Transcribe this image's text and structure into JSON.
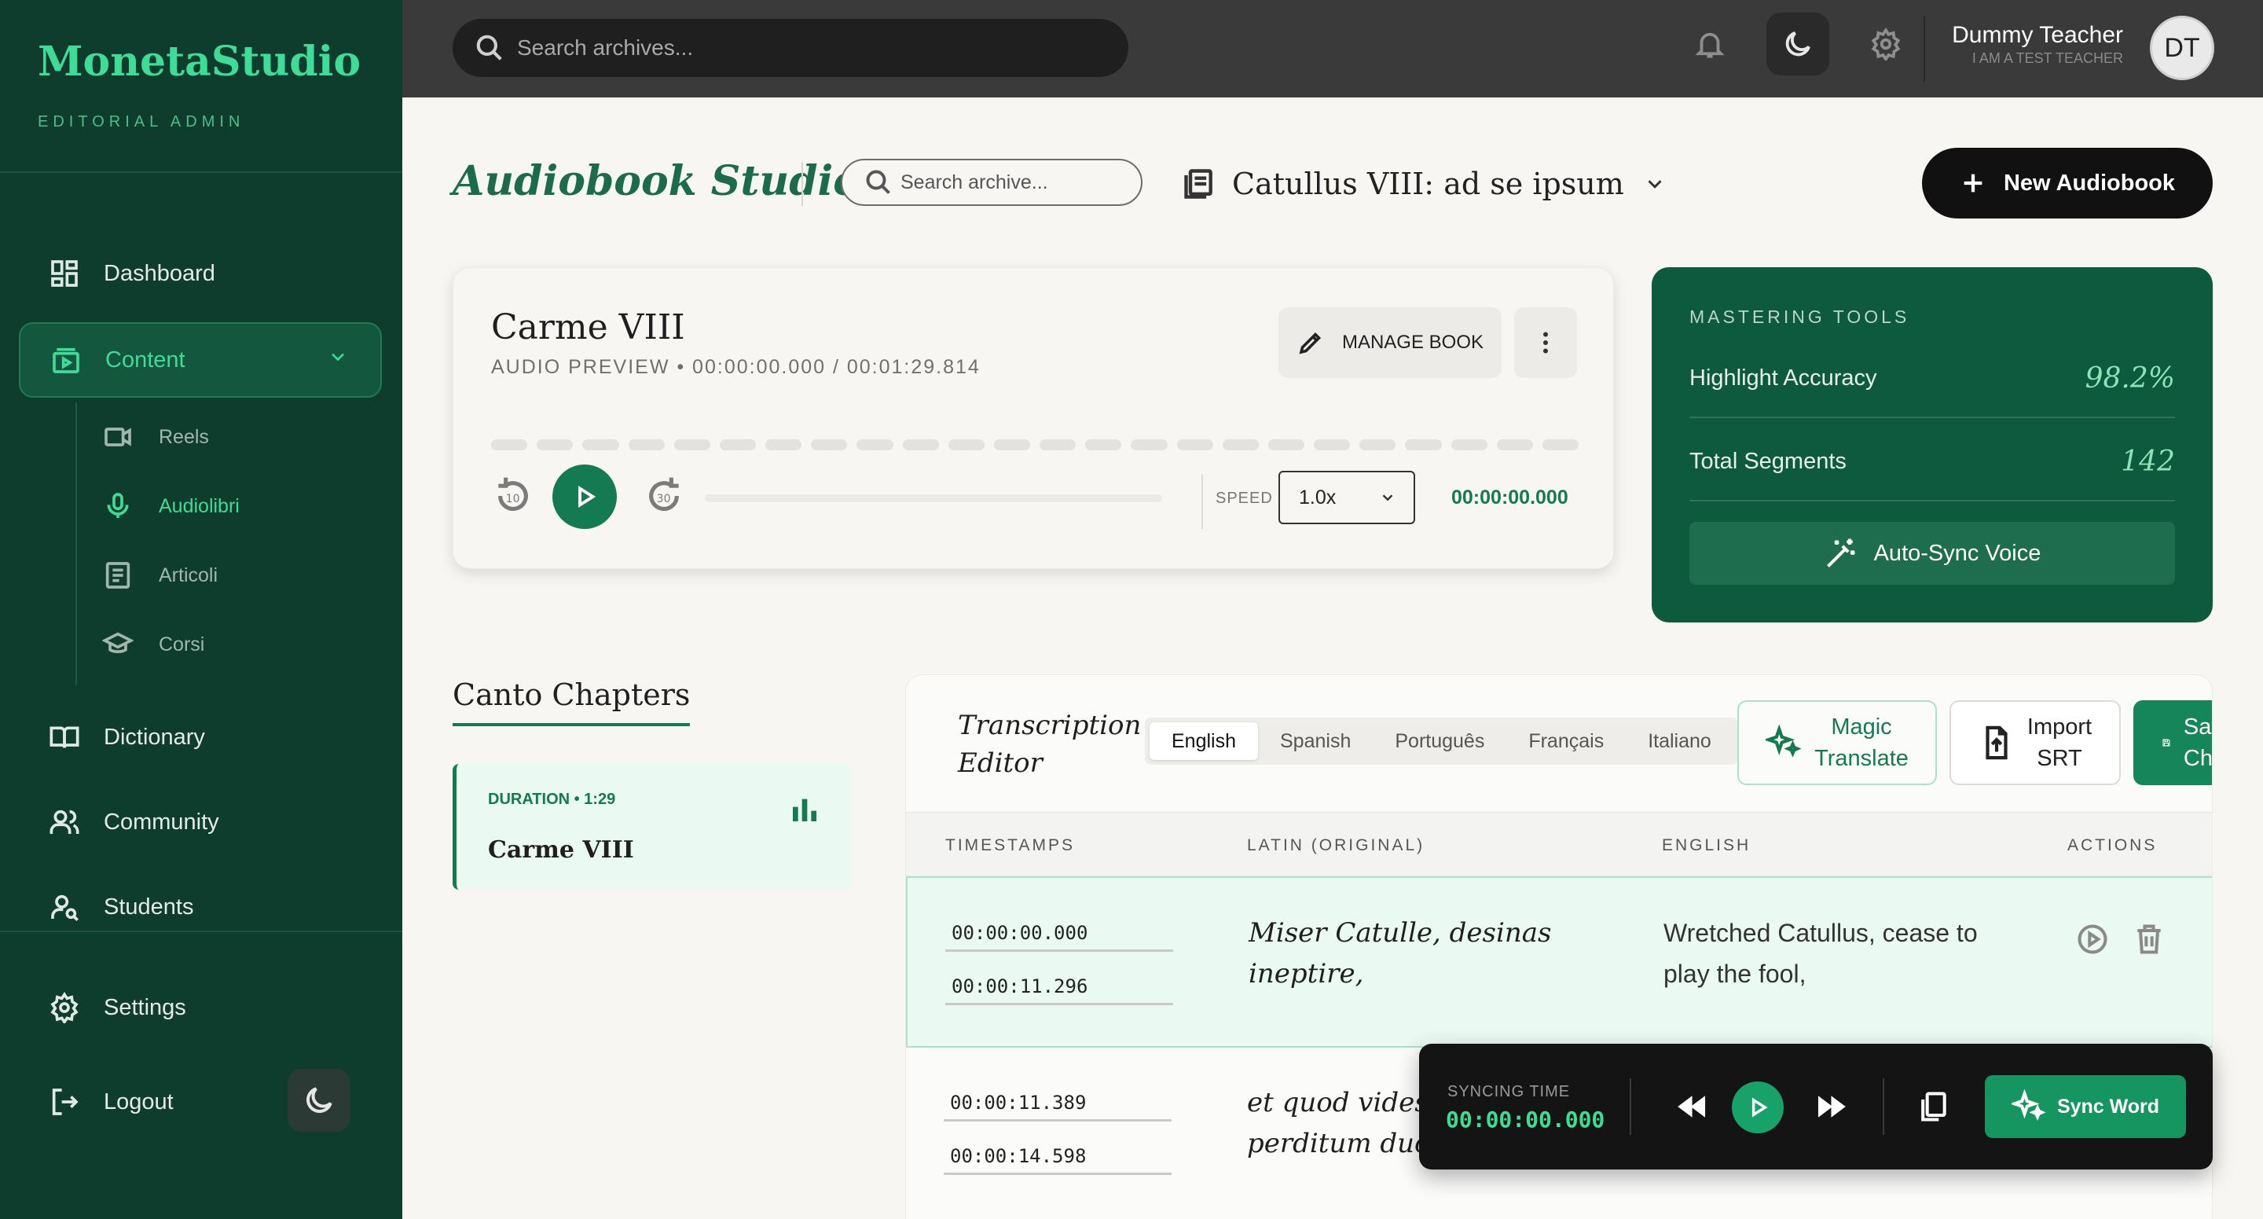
{
  "sidebar": {
    "brand": "MonetaStudio",
    "subtitle": "EDITORIAL ADMIN",
    "items": {
      "dashboard": "Dashboard",
      "content": "Content",
      "dictionary": "Dictionary",
      "community": "Community",
      "students": "Students",
      "settings": "Settings",
      "logout": "Logout"
    },
    "content_children": {
      "reels": "Reels",
      "audiolibri": "Audiolibri",
      "articoli": "Articoli",
      "corsi": "Corsi"
    }
  },
  "topbar": {
    "search_placeholder": "Search archives...",
    "user_name": "Dummy Teacher",
    "user_role": "I AM A TEST TEACHER",
    "avatar_initials": "DT"
  },
  "header": {
    "title": "Audiobook Studio",
    "archive_search_placeholder": "Search archive...",
    "selected_book": "Catullus VIII: ad se ipsum",
    "new_button": "New Audiobook"
  },
  "preview": {
    "title": "Carme VIII",
    "subtitle": "AUDIO PREVIEW • 00:00:00.000 / 00:01:29.814",
    "manage_label": "MANAGE BOOK",
    "speed_label": "SPEED",
    "speed_value": "1.0x",
    "current_time": "00:00:00.000",
    "progress": 0
  },
  "mastering": {
    "title": "MASTERING TOOLS",
    "rows": [
      {
        "label": "Highlight Accuracy",
        "value": "98.2%"
      },
      {
        "label": "Total Segments",
        "value": "142"
      }
    ],
    "button": "Auto-Sync Voice"
  },
  "chapters": {
    "title": "Canto Chapters",
    "items": [
      {
        "duration": "DURATION • 1:29",
        "name": "Carme VIII"
      }
    ]
  },
  "editor": {
    "title_line1": "Transcription",
    "title_line2": "Editor",
    "languages": [
      "English",
      "Spanish",
      "Português",
      "Français",
      "Italiano"
    ],
    "active_language": "English",
    "magic_line1": "Magic",
    "magic_line2": "Translate",
    "import_line1": "Import",
    "import_line2": "SRT",
    "save_line1": "Save",
    "save_line2": "Changes",
    "columns": [
      "TIMESTAMPS",
      "LATIN (ORIGINAL)",
      "ENGLISH",
      "ACTIONS"
    ],
    "rows": [
      {
        "start": "00:00:00.000",
        "end": "00:00:11.296",
        "latin": "Miser Catulle, desinas ineptire,",
        "english": "Wretched Catullus, cease to play the fool,"
      },
      {
        "start": "00:00:11.389",
        "end": "00:00:14.598",
        "latin": "et quod vides perire perditum ducas.",
        "english": ""
      }
    ]
  },
  "syncbar": {
    "label": "SYNCING TIME",
    "time": "00:00:00.000",
    "sync_button": "Sync Word"
  },
  "colors": {
    "sidebar_bg": "#0f3d2d",
    "accent": "#137a52",
    "accent_bright": "#3ddc97",
    "mastering_bg": "#0d5a3e"
  },
  "icons": [
    "dashboard-icon",
    "content-icon",
    "chevron-down-icon",
    "video-icon",
    "mic-icon",
    "article-icon",
    "graduation-cap-icon",
    "book-icon",
    "users-icon",
    "student-icon",
    "gear-icon",
    "logout-icon",
    "moon-icon",
    "search-icon",
    "bell-icon",
    "document-icon",
    "plus-icon",
    "pencil-icon",
    "more-vertical-icon",
    "rewind-10-icon",
    "play-icon",
    "forward-30-icon",
    "magic-wand-icon",
    "bar-chart-icon",
    "sparkles-icon",
    "file-upload-icon",
    "save-icon",
    "play-circle-icon",
    "trash-icon",
    "rewind-icon",
    "fast-forward-icon",
    "copy-icon"
  ]
}
